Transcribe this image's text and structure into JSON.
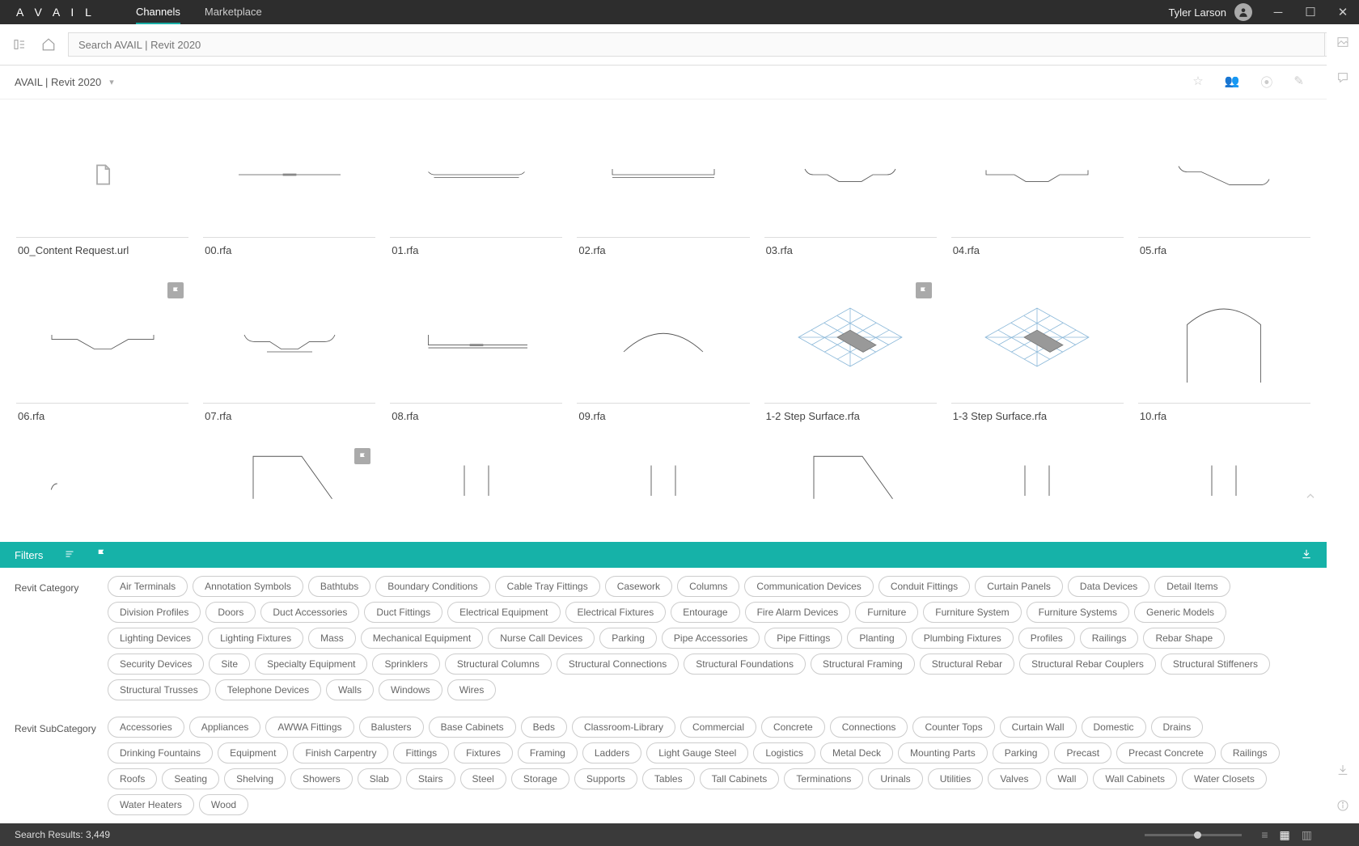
{
  "app": {
    "logo": "A V A I L",
    "user_name": "Tyler Larson"
  },
  "nav": {
    "tabs": [
      "Channels",
      "Marketplace"
    ],
    "active": 0
  },
  "search": {
    "placeholder": "Search AVAIL | Revit 2020"
  },
  "breadcrumb": "AVAIL | Revit 2020",
  "items": [
    {
      "name": "00_Content Request.url",
      "thumb": "doc"
    },
    {
      "name": "00.rfa",
      "thumb": "flat_plus"
    },
    {
      "name": "01.rfa",
      "thumb": "tray_up"
    },
    {
      "name": "02.rfa",
      "thumb": "tray_down"
    },
    {
      "name": "03.rfa",
      "thumb": "tray_curl"
    },
    {
      "name": "04.rfa",
      "thumb": "tray_step"
    },
    {
      "name": "05.rfa",
      "thumb": "step_curl"
    },
    {
      "name": "06.rfa",
      "thumb": "trap_down",
      "flag": true
    },
    {
      "name": "07.rfa",
      "thumb": "tray_curl2"
    },
    {
      "name": "08.rfa",
      "thumb": "l_rail"
    },
    {
      "name": "09.rfa",
      "thumb": "arch"
    },
    {
      "name": "1-2 Step Surface.rfa",
      "thumb": "iso_grid",
      "flag": true
    },
    {
      "name": "1-3 Step Surface.rfa",
      "thumb": "iso_grid"
    },
    {
      "name": "10.rfa",
      "thumb": "arch_tall"
    },
    {
      "name": "",
      "thumb": "partial1"
    },
    {
      "name": "",
      "thumb": "partial2",
      "flag": true
    },
    {
      "name": "",
      "thumb": "partial3"
    },
    {
      "name": "",
      "thumb": "partial3"
    },
    {
      "name": "",
      "thumb": "partial2"
    },
    {
      "name": "",
      "thumb": "partial3"
    },
    {
      "name": "",
      "thumb": "partial3"
    }
  ],
  "filters": {
    "title": "Filters",
    "groups": [
      {
        "label": "Revit Category",
        "values": [
          "Air Terminals",
          "Annotation Symbols",
          "Bathtubs",
          "Boundary Conditions",
          "Cable Tray Fittings",
          "Casework",
          "Columns",
          "Communication Devices",
          "Conduit Fittings",
          "Curtain Panels",
          "Data Devices",
          "Detail Items",
          "Division Profiles",
          "Doors",
          "Duct Accessories",
          "Duct Fittings",
          "Electrical Equipment",
          "Electrical Fixtures",
          "Entourage",
          "Fire Alarm Devices",
          "Furniture",
          "Furniture System",
          "Furniture Systems",
          "Generic Models",
          "Lighting Devices",
          "Lighting Fixtures",
          "Mass",
          "Mechanical Equipment",
          "Nurse Call Devices",
          "Parking",
          "Pipe Accessories",
          "Pipe Fittings",
          "Planting",
          "Plumbing Fixtures",
          "Profiles",
          "Railings",
          "Rebar Shape",
          "Security Devices",
          "Site",
          "Specialty Equipment",
          "Sprinklers",
          "Structural Columns",
          "Structural Connections",
          "Structural Foundations",
          "Structural Framing",
          "Structural Rebar",
          "Structural Rebar Couplers",
          "Structural Stiffeners",
          "Structural Trusses",
          "Telephone Devices",
          "Walls",
          "Windows",
          "Wires"
        ]
      },
      {
        "label": "Revit SubCategory",
        "values": [
          "Accessories",
          "Appliances",
          "AWWA Fittings",
          "Balusters",
          "Base Cabinets",
          "Beds",
          "Classroom-Library",
          "Commercial",
          "Concrete",
          "Connections",
          "Counter Tops",
          "Curtain Wall",
          "Domestic",
          "Drains",
          "Drinking Fountains",
          "Equipment",
          "Finish Carpentry",
          "Fittings",
          "Fixtures",
          "Framing",
          "Ladders",
          "Light Gauge Steel",
          "Logistics",
          "Metal Deck",
          "Mounting Parts",
          "Parking",
          "Precast",
          "Precast Concrete",
          "Railings",
          "Roofs",
          "Seating",
          "Shelving",
          "Showers",
          "Slab",
          "Stairs",
          "Steel",
          "Storage",
          "Supports",
          "Tables",
          "Tall Cabinets",
          "Terminations",
          "Urinals",
          "Utilities",
          "Valves",
          "Wall",
          "Wall Cabinets",
          "Water Closets",
          "Water Heaters",
          "Wood"
        ]
      }
    ]
  },
  "status": {
    "results": "Search Results: 3,449"
  }
}
